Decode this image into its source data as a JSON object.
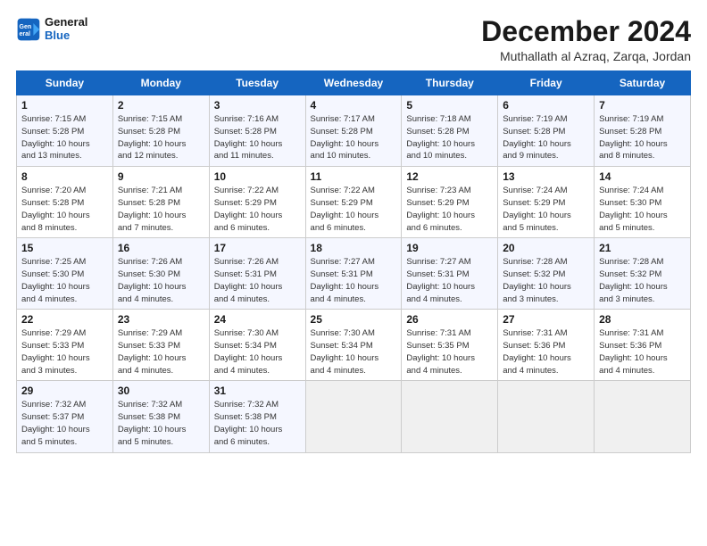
{
  "logo": {
    "line1": "General",
    "line2": "Blue"
  },
  "title": "December 2024",
  "location": "Muthallath al Azraq, Zarqa, Jordan",
  "weekdays": [
    "Sunday",
    "Monday",
    "Tuesday",
    "Wednesday",
    "Thursday",
    "Friday",
    "Saturday"
  ],
  "weeks": [
    [
      {
        "day": "1",
        "info": "Sunrise: 7:15 AM\nSunset: 5:28 PM\nDaylight: 10 hours\nand 13 minutes."
      },
      {
        "day": "2",
        "info": "Sunrise: 7:15 AM\nSunset: 5:28 PM\nDaylight: 10 hours\nand 12 minutes."
      },
      {
        "day": "3",
        "info": "Sunrise: 7:16 AM\nSunset: 5:28 PM\nDaylight: 10 hours\nand 11 minutes."
      },
      {
        "day": "4",
        "info": "Sunrise: 7:17 AM\nSunset: 5:28 PM\nDaylight: 10 hours\nand 10 minutes."
      },
      {
        "day": "5",
        "info": "Sunrise: 7:18 AM\nSunset: 5:28 PM\nDaylight: 10 hours\nand 10 minutes."
      },
      {
        "day": "6",
        "info": "Sunrise: 7:19 AM\nSunset: 5:28 PM\nDaylight: 10 hours\nand 9 minutes."
      },
      {
        "day": "7",
        "info": "Sunrise: 7:19 AM\nSunset: 5:28 PM\nDaylight: 10 hours\nand 8 minutes."
      }
    ],
    [
      {
        "day": "8",
        "info": "Sunrise: 7:20 AM\nSunset: 5:28 PM\nDaylight: 10 hours\nand 8 minutes."
      },
      {
        "day": "9",
        "info": "Sunrise: 7:21 AM\nSunset: 5:28 PM\nDaylight: 10 hours\nand 7 minutes."
      },
      {
        "day": "10",
        "info": "Sunrise: 7:22 AM\nSunset: 5:29 PM\nDaylight: 10 hours\nand 6 minutes."
      },
      {
        "day": "11",
        "info": "Sunrise: 7:22 AM\nSunset: 5:29 PM\nDaylight: 10 hours\nand 6 minutes."
      },
      {
        "day": "12",
        "info": "Sunrise: 7:23 AM\nSunset: 5:29 PM\nDaylight: 10 hours\nand 6 minutes."
      },
      {
        "day": "13",
        "info": "Sunrise: 7:24 AM\nSunset: 5:29 PM\nDaylight: 10 hours\nand 5 minutes."
      },
      {
        "day": "14",
        "info": "Sunrise: 7:24 AM\nSunset: 5:30 PM\nDaylight: 10 hours\nand 5 minutes."
      }
    ],
    [
      {
        "day": "15",
        "info": "Sunrise: 7:25 AM\nSunset: 5:30 PM\nDaylight: 10 hours\nand 4 minutes."
      },
      {
        "day": "16",
        "info": "Sunrise: 7:26 AM\nSunset: 5:30 PM\nDaylight: 10 hours\nand 4 minutes."
      },
      {
        "day": "17",
        "info": "Sunrise: 7:26 AM\nSunset: 5:31 PM\nDaylight: 10 hours\nand 4 minutes."
      },
      {
        "day": "18",
        "info": "Sunrise: 7:27 AM\nSunset: 5:31 PM\nDaylight: 10 hours\nand 4 minutes."
      },
      {
        "day": "19",
        "info": "Sunrise: 7:27 AM\nSunset: 5:31 PM\nDaylight: 10 hours\nand 4 minutes."
      },
      {
        "day": "20",
        "info": "Sunrise: 7:28 AM\nSunset: 5:32 PM\nDaylight: 10 hours\nand 3 minutes."
      },
      {
        "day": "21",
        "info": "Sunrise: 7:28 AM\nSunset: 5:32 PM\nDaylight: 10 hours\nand 3 minutes."
      }
    ],
    [
      {
        "day": "22",
        "info": "Sunrise: 7:29 AM\nSunset: 5:33 PM\nDaylight: 10 hours\nand 3 minutes."
      },
      {
        "day": "23",
        "info": "Sunrise: 7:29 AM\nSunset: 5:33 PM\nDaylight: 10 hours\nand 4 minutes."
      },
      {
        "day": "24",
        "info": "Sunrise: 7:30 AM\nSunset: 5:34 PM\nDaylight: 10 hours\nand 4 minutes."
      },
      {
        "day": "25",
        "info": "Sunrise: 7:30 AM\nSunset: 5:34 PM\nDaylight: 10 hours\nand 4 minutes."
      },
      {
        "day": "26",
        "info": "Sunrise: 7:31 AM\nSunset: 5:35 PM\nDaylight: 10 hours\nand 4 minutes."
      },
      {
        "day": "27",
        "info": "Sunrise: 7:31 AM\nSunset: 5:36 PM\nDaylight: 10 hours\nand 4 minutes."
      },
      {
        "day": "28",
        "info": "Sunrise: 7:31 AM\nSunset: 5:36 PM\nDaylight: 10 hours\nand 4 minutes."
      }
    ],
    [
      {
        "day": "29",
        "info": "Sunrise: 7:32 AM\nSunset: 5:37 PM\nDaylight: 10 hours\nand 5 minutes."
      },
      {
        "day": "30",
        "info": "Sunrise: 7:32 AM\nSunset: 5:38 PM\nDaylight: 10 hours\nand 5 minutes."
      },
      {
        "day": "31",
        "info": "Sunrise: 7:32 AM\nSunset: 5:38 PM\nDaylight: 10 hours\nand 6 minutes."
      },
      null,
      null,
      null,
      null
    ]
  ]
}
